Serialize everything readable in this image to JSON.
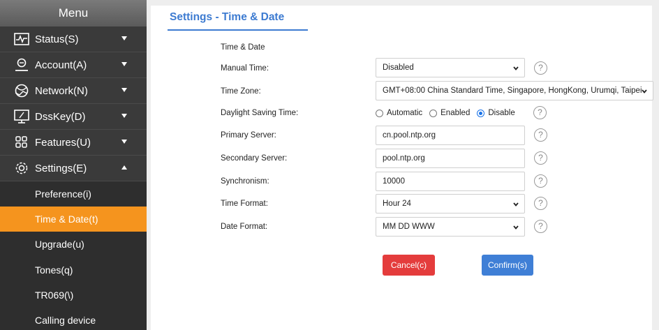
{
  "sidebar": {
    "header": "Menu",
    "items": [
      {
        "label": "Status(S)",
        "icon": "status-icon"
      },
      {
        "label": "Account(A)",
        "icon": "account-icon"
      },
      {
        "label": "Network(N)",
        "icon": "network-icon"
      },
      {
        "label": "DssKey(D)",
        "icon": "dsskey-icon"
      },
      {
        "label": "Features(U)",
        "icon": "features-icon"
      },
      {
        "label": "Settings(E)",
        "icon": "settings-icon"
      }
    ],
    "sub_items": [
      {
        "label": "Preference(i)"
      },
      {
        "label": "Time & Date(t)",
        "active": true
      },
      {
        "label": "Upgrade(u)"
      },
      {
        "label": "Tones(q)"
      },
      {
        "label": "TR069(\\)"
      },
      {
        "label": "Calling device"
      }
    ]
  },
  "page": {
    "title": "Settings - Time & Date",
    "section": "Time & Date"
  },
  "form": {
    "manual_time": {
      "label": "Manual Time:",
      "value": "Disabled"
    },
    "time_zone": {
      "label": "Time Zone:",
      "value": "GMT+08:00 China Standard Time, Singapore, HongKong, Urumqi, Taipei"
    },
    "dst": {
      "label": "Daylight Saving Time:",
      "options": [
        "Automatic",
        "Enabled",
        "Disable"
      ],
      "selected": "Disable"
    },
    "primary_server": {
      "label": "Primary Server:",
      "value": "cn.pool.ntp.org"
    },
    "secondary_server": {
      "label": "Secondary Server:",
      "value": "pool.ntp.org"
    },
    "synchronism": {
      "label": "Synchronism:",
      "value": "10000"
    },
    "time_format": {
      "label": "Time Format:",
      "value": "Hour 24"
    },
    "date_format": {
      "label": "Date Format:",
      "value": "MM DD WWW"
    },
    "help_glyph": "?"
  },
  "buttons": {
    "cancel": "Cancel(c)",
    "confirm": "Confirm(s)"
  },
  "colors": {
    "accent": "#3d7bd1",
    "active_menu": "#f5941e",
    "cancel": "#e43c3c",
    "confirm": "#3f7fd6"
  }
}
